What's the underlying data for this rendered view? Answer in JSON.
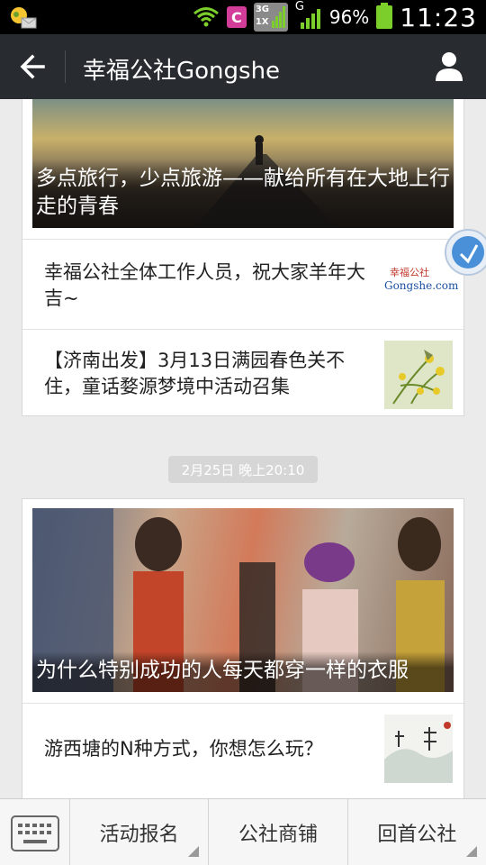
{
  "status_bar": {
    "carrier_icon": "phone-app-icon",
    "network_3g": "3G",
    "network_1x": "1X",
    "network_g": "G",
    "battery_percent": "96%",
    "time": "11:23"
  },
  "header": {
    "title": "幸福公社Gongshe"
  },
  "feed": {
    "group1": {
      "hero_caption": "多点旅行，少点旅游——献给所有在大地上行走的青春",
      "items": [
        {
          "title": "幸福公社全体工作人员，祝大家羊年大吉~",
          "thumb_text_cn": "幸福公社",
          "thumb_text_en": "Gongshe.com"
        },
        {
          "title": "【济南出发】3月13日满园春色关不住，童话婺源梦境中活动召集"
        }
      ]
    },
    "timestamp": "2月25日 晚上20:10",
    "group2": {
      "hero_caption": "为什么特别成功的人每天都穿一样的衣服",
      "items": [
        {
          "title": "游西塘的N种方式，你想怎么玩？"
        }
      ]
    }
  },
  "bottom_menu": {
    "items": [
      "活动报名",
      "公社商铺",
      "回首公社"
    ]
  },
  "colors": {
    "header_bg": "#282c30",
    "page_bg": "#ebebeb",
    "battery": "#7ccf2a"
  }
}
